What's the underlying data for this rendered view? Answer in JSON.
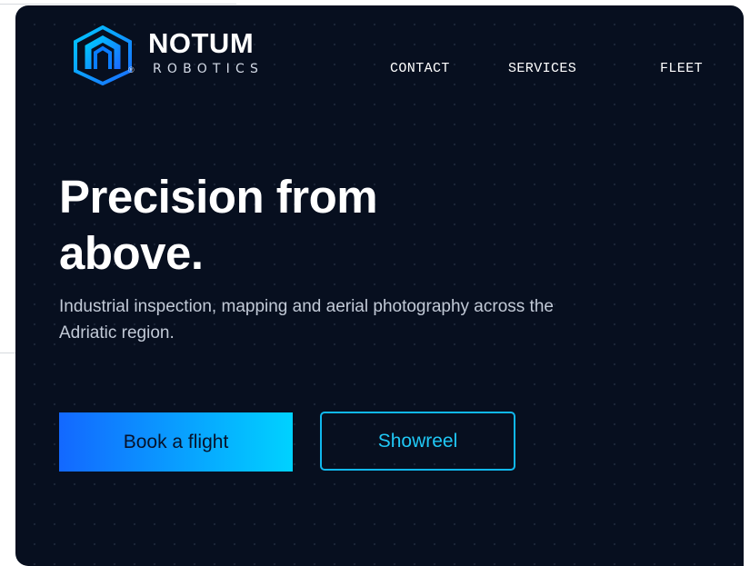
{
  "brand": {
    "name": "NOTUM",
    "tagline": "ROBOTICS",
    "registered_mark": "®",
    "logo_icon": "notum-hexagon-logo-icon",
    "logo_colors": [
      "#1a73ff",
      "#00c8ff"
    ]
  },
  "nav": {
    "items": [
      {
        "label": "CONTACT"
      },
      {
        "label": "SERVICES"
      },
      {
        "label": "FLEET"
      }
    ]
  },
  "hero": {
    "headline": "Precision from above.",
    "lede": "Industrial inspection, mapping and aerial photography across the Adriatic region.",
    "primary_cta": "Book a flight",
    "secondary_cta": "Showreel"
  },
  "colors": {
    "background": "#070f1f",
    "accent_start": "#1368ff",
    "accent_end": "#00d2ff",
    "outline_accent": "#10b8ee"
  }
}
